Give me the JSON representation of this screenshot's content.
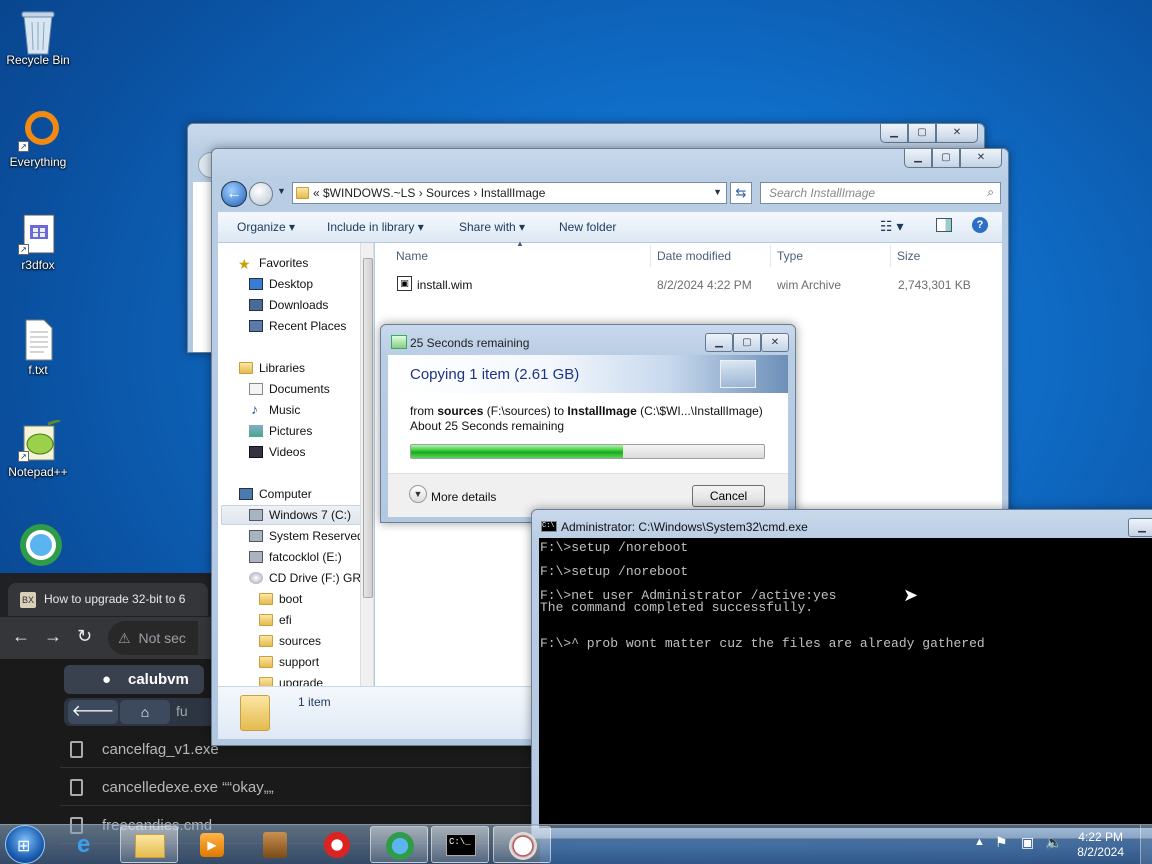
{
  "desktop": {
    "icons": [
      {
        "label": "Recycle Bin"
      },
      {
        "label": "Everything"
      },
      {
        "label": "r3dfox"
      },
      {
        "label": "f.txt"
      },
      {
        "label": "Notepad++"
      }
    ]
  },
  "browser": {
    "tab_title": "How to upgrade 32-bit to 6",
    "favicon_text": "BX",
    "address_text": "Not sec",
    "ftp_user": "calubvm",
    "ftp_path": "fu",
    "files": [
      "cancelfag_v1.exe",
      "cancelledexe.exe ““okay„„",
      "freecandies.cmd"
    ]
  },
  "explorer": {
    "breadcrumb": "«  $WINDOWS.~LS  ›  Sources  ›  InstallImage",
    "search_placeholder": "Search InstallImage",
    "toolbar": {
      "organize": "Organize ▾",
      "include": "Include in library ▾",
      "share": "Share with ▾",
      "new_folder": "New folder"
    },
    "nav": {
      "favorites": "Favorites",
      "desktop": "Desktop",
      "downloads": "Downloads",
      "recent": "Recent Places",
      "libraries": "Libraries",
      "documents": "Documents",
      "music": "Music",
      "pictures": "Pictures",
      "videos": "Videos",
      "computer": "Computer",
      "win7": "Windows 7 (C:)",
      "sysres": "System Reserved",
      "fatcock": "fatcocklol (E:)",
      "cddrive": "CD Drive (F:) GRM",
      "boot": "boot",
      "efi": "efi",
      "sources": "sources",
      "support": "support",
      "upgrade": "upgrade"
    },
    "columns": {
      "name": "Name",
      "date": "Date modified",
      "type": "Type",
      "size": "Size"
    },
    "file": {
      "name": "install.wim",
      "date": "8/2/2024 4:22 PM",
      "type": "wim Archive",
      "size": "2,743,301 KB"
    },
    "status": "1 item"
  },
  "copy_dialog": {
    "title": "25 Seconds remaining",
    "heading": "Copying 1 item (2.61 GB)",
    "from_prefix": "from ",
    "from_src": "sources",
    "from_src_path": " (F:\\sources) to ",
    "to_dst": "InstallImage",
    "to_dst_path": " (C:\\$WI...\\InstallImage)",
    "remaining": "About 25 Seconds remaining",
    "progress": 0.6,
    "more_details": "More details",
    "cancel": "Cancel"
  },
  "cmd": {
    "title": "Administrator: C:\\Windows\\System32\\cmd.exe",
    "icon_text": "C:\\",
    "lines": [
      "F:\\>setup /noreboot",
      "",
      "F:\\>setup /noreboot",
      "",
      "F:\\>net user Administrator /active:yes",
      "The command completed successfully.",
      "",
      "",
      "F:\\>^ prob wont matter cuz the files are already gathered"
    ]
  },
  "taskbar": {
    "time": "4:22 PM",
    "date": "8/2/2024"
  },
  "colors": {
    "progress_green": "#19a919",
    "console_bg": "#000000",
    "console_fg": "#c0c0c0"
  }
}
